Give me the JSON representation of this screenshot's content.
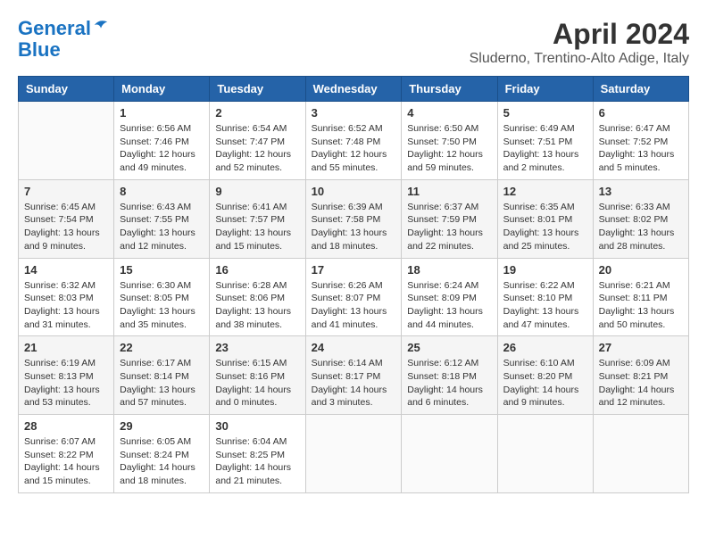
{
  "header": {
    "logo_line1": "General",
    "logo_line2": "Blue",
    "month_title": "April 2024",
    "location": "Sluderno, Trentino-Alto Adige, Italy"
  },
  "weekdays": [
    "Sunday",
    "Monday",
    "Tuesday",
    "Wednesday",
    "Thursday",
    "Friday",
    "Saturday"
  ],
  "weeks": [
    [
      {
        "day": "",
        "info": ""
      },
      {
        "day": "1",
        "info": "Sunrise: 6:56 AM\nSunset: 7:46 PM\nDaylight: 12 hours\nand 49 minutes."
      },
      {
        "day": "2",
        "info": "Sunrise: 6:54 AM\nSunset: 7:47 PM\nDaylight: 12 hours\nand 52 minutes."
      },
      {
        "day": "3",
        "info": "Sunrise: 6:52 AM\nSunset: 7:48 PM\nDaylight: 12 hours\nand 55 minutes."
      },
      {
        "day": "4",
        "info": "Sunrise: 6:50 AM\nSunset: 7:50 PM\nDaylight: 12 hours\nand 59 minutes."
      },
      {
        "day": "5",
        "info": "Sunrise: 6:49 AM\nSunset: 7:51 PM\nDaylight: 13 hours\nand 2 minutes."
      },
      {
        "day": "6",
        "info": "Sunrise: 6:47 AM\nSunset: 7:52 PM\nDaylight: 13 hours\nand 5 minutes."
      }
    ],
    [
      {
        "day": "7",
        "info": "Sunrise: 6:45 AM\nSunset: 7:54 PM\nDaylight: 13 hours\nand 9 minutes."
      },
      {
        "day": "8",
        "info": "Sunrise: 6:43 AM\nSunset: 7:55 PM\nDaylight: 13 hours\nand 12 minutes."
      },
      {
        "day": "9",
        "info": "Sunrise: 6:41 AM\nSunset: 7:57 PM\nDaylight: 13 hours\nand 15 minutes."
      },
      {
        "day": "10",
        "info": "Sunrise: 6:39 AM\nSunset: 7:58 PM\nDaylight: 13 hours\nand 18 minutes."
      },
      {
        "day": "11",
        "info": "Sunrise: 6:37 AM\nSunset: 7:59 PM\nDaylight: 13 hours\nand 22 minutes."
      },
      {
        "day": "12",
        "info": "Sunrise: 6:35 AM\nSunset: 8:01 PM\nDaylight: 13 hours\nand 25 minutes."
      },
      {
        "day": "13",
        "info": "Sunrise: 6:33 AM\nSunset: 8:02 PM\nDaylight: 13 hours\nand 28 minutes."
      }
    ],
    [
      {
        "day": "14",
        "info": "Sunrise: 6:32 AM\nSunset: 8:03 PM\nDaylight: 13 hours\nand 31 minutes."
      },
      {
        "day": "15",
        "info": "Sunrise: 6:30 AM\nSunset: 8:05 PM\nDaylight: 13 hours\nand 35 minutes."
      },
      {
        "day": "16",
        "info": "Sunrise: 6:28 AM\nSunset: 8:06 PM\nDaylight: 13 hours\nand 38 minutes."
      },
      {
        "day": "17",
        "info": "Sunrise: 6:26 AM\nSunset: 8:07 PM\nDaylight: 13 hours\nand 41 minutes."
      },
      {
        "day": "18",
        "info": "Sunrise: 6:24 AM\nSunset: 8:09 PM\nDaylight: 13 hours\nand 44 minutes."
      },
      {
        "day": "19",
        "info": "Sunrise: 6:22 AM\nSunset: 8:10 PM\nDaylight: 13 hours\nand 47 minutes."
      },
      {
        "day": "20",
        "info": "Sunrise: 6:21 AM\nSunset: 8:11 PM\nDaylight: 13 hours\nand 50 minutes."
      }
    ],
    [
      {
        "day": "21",
        "info": "Sunrise: 6:19 AM\nSunset: 8:13 PM\nDaylight: 13 hours\nand 53 minutes."
      },
      {
        "day": "22",
        "info": "Sunrise: 6:17 AM\nSunset: 8:14 PM\nDaylight: 13 hours\nand 57 minutes."
      },
      {
        "day": "23",
        "info": "Sunrise: 6:15 AM\nSunset: 8:16 PM\nDaylight: 14 hours\nand 0 minutes."
      },
      {
        "day": "24",
        "info": "Sunrise: 6:14 AM\nSunset: 8:17 PM\nDaylight: 14 hours\nand 3 minutes."
      },
      {
        "day": "25",
        "info": "Sunrise: 6:12 AM\nSunset: 8:18 PM\nDaylight: 14 hours\nand 6 minutes."
      },
      {
        "day": "26",
        "info": "Sunrise: 6:10 AM\nSunset: 8:20 PM\nDaylight: 14 hours\nand 9 minutes."
      },
      {
        "day": "27",
        "info": "Sunrise: 6:09 AM\nSunset: 8:21 PM\nDaylight: 14 hours\nand 12 minutes."
      }
    ],
    [
      {
        "day": "28",
        "info": "Sunrise: 6:07 AM\nSunset: 8:22 PM\nDaylight: 14 hours\nand 15 minutes."
      },
      {
        "day": "29",
        "info": "Sunrise: 6:05 AM\nSunset: 8:24 PM\nDaylight: 14 hours\nand 18 minutes."
      },
      {
        "day": "30",
        "info": "Sunrise: 6:04 AM\nSunset: 8:25 PM\nDaylight: 14 hours\nand 21 minutes."
      },
      {
        "day": "",
        "info": ""
      },
      {
        "day": "",
        "info": ""
      },
      {
        "day": "",
        "info": ""
      },
      {
        "day": "",
        "info": ""
      }
    ]
  ]
}
